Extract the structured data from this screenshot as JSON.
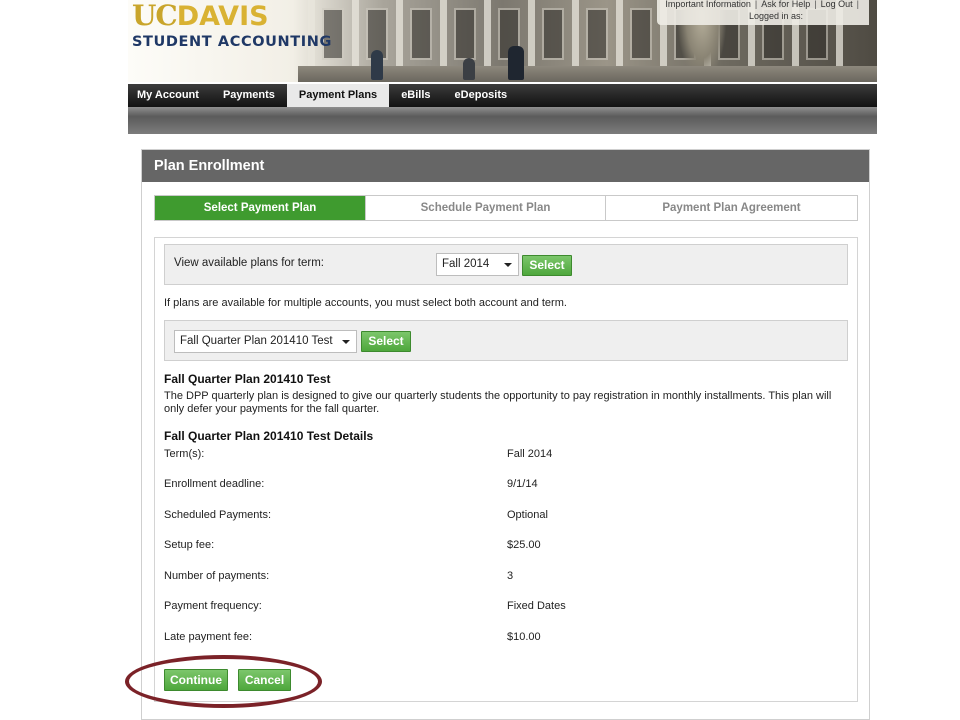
{
  "header": {
    "logo_uc": "UC",
    "logo_davis": "DAVIS",
    "logo_subtitle": "STUDENT ACCOUNTING",
    "utility_links": [
      "Important Information",
      "Ask for Help",
      "Log Out"
    ],
    "logged_in_label": "Logged in as:"
  },
  "nav": {
    "items": [
      {
        "label": "My Account"
      },
      {
        "label": "Payments"
      },
      {
        "label": "Payment Plans"
      },
      {
        "label": "eBills"
      },
      {
        "label": "eDeposits"
      }
    ],
    "active": "Payment Plans"
  },
  "panel": {
    "title": "Plan Enrollment",
    "steps": [
      {
        "label": "Select Payment Plan",
        "active": true
      },
      {
        "label": "Schedule Payment Plan",
        "active": false
      },
      {
        "label": "Payment Plan Agreement",
        "active": false
      }
    ]
  },
  "term_selector": {
    "label": "View available plans for term:",
    "selected": "Fall 2014",
    "button_label": "Select"
  },
  "note": "If plans are available for multiple accounts, you must select both account and term.",
  "plan_selector": {
    "selected": "Fall Quarter Plan 201410 Test",
    "button_label": "Select"
  },
  "plan": {
    "name": "Fall Quarter Plan 201410 Test",
    "description": "The DPP quarterly plan is designed to give our quarterly students the opportunity to pay registration in monthly installments. This plan will only defer your payments for the fall quarter.",
    "details_heading": "Fall Quarter Plan 201410 Test Details",
    "details": [
      {
        "label": "Term(s):",
        "value": "Fall 2014"
      },
      {
        "label": "Enrollment deadline:",
        "value": "9/1/14"
      },
      {
        "label": "Scheduled Payments:",
        "value": "Optional"
      },
      {
        "label": "Setup fee:",
        "value": "$25.00"
      },
      {
        "label": "Number of payments:",
        "value": "3"
      },
      {
        "label": "Payment frequency:",
        "value": "Fixed Dates"
      },
      {
        "label": "Late payment fee:",
        "value": "$10.00"
      }
    ]
  },
  "actions": {
    "continue_label": "Continue",
    "cancel_label": "Cancel"
  },
  "colors": {
    "brand_gold": "#c9a52b",
    "brand_navy": "#1f3866",
    "accent_green": "#3f9b2f",
    "highlight_ring": "#7b2228"
  }
}
